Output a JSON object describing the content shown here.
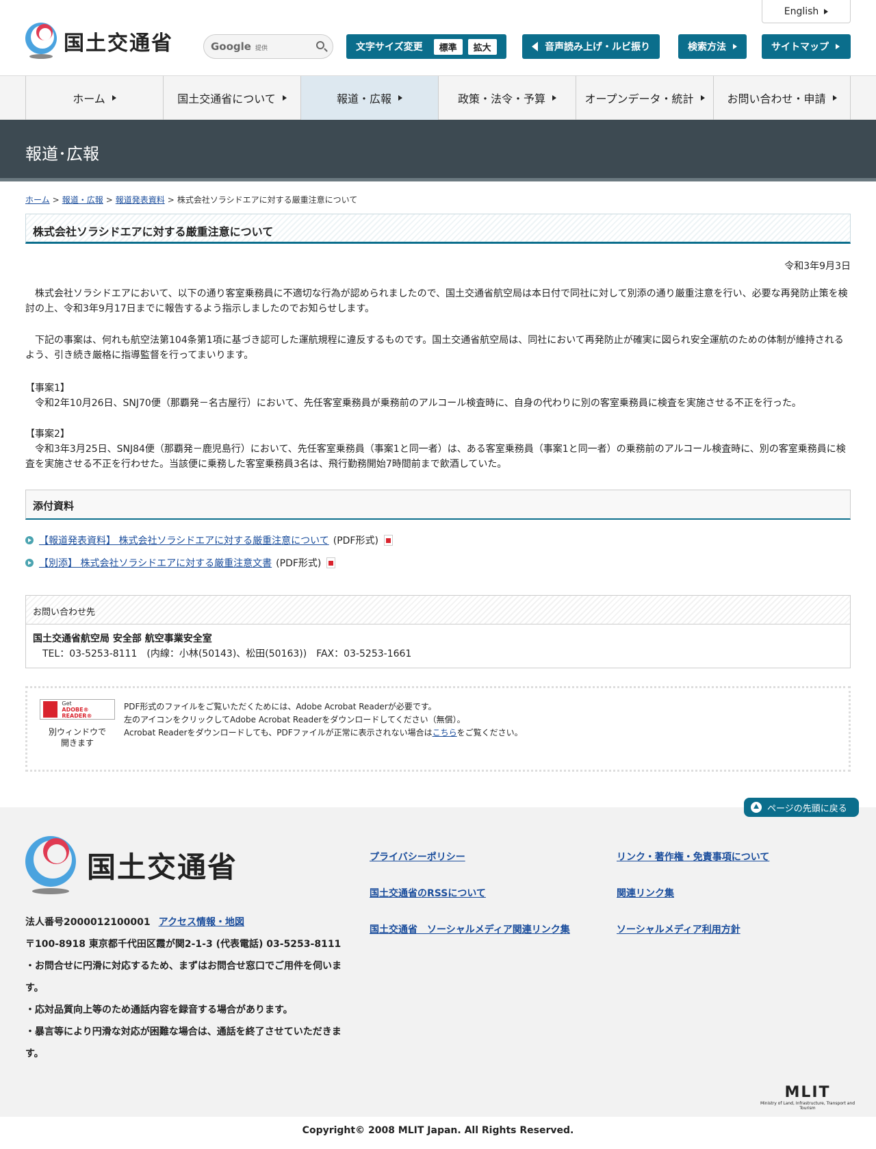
{
  "header": {
    "logo_text": "国土交通省",
    "english_label": "English",
    "search": {
      "brand": "Google",
      "provided": "提供"
    },
    "font_size": {
      "label": "文字サイズ変更",
      "standard": "標準",
      "large": "拡大"
    },
    "speech_label": "音声読み上げ・ルビ振り",
    "search_method_label": "検索方法",
    "sitemap_label": "サイトマップ"
  },
  "nav": {
    "items": [
      {
        "label": "ホーム"
      },
      {
        "label": "国土交通省について"
      },
      {
        "label": "報道・広報"
      },
      {
        "label": "政策・法令・予算"
      },
      {
        "label": "オープンデータ・統計"
      },
      {
        "label": "お問い合わせ・申請"
      }
    ]
  },
  "page_title": "報道･広報",
  "breadcrumb": {
    "home": "ホーム",
    "press": "報道・広報",
    "releases": "報道発表資料",
    "current": "株式会社ソラシドエアに対する厳重注意について",
    "sep": ">"
  },
  "article": {
    "title": "株式会社ソラシドエアに対する厳重注意について",
    "date": "令和3年9月3日",
    "para1": "　株式会社ソラシドエアにおいて、以下の通り客室乗務員に不適切な行為が認められましたので、国土交通省航空局は本日付で同社に対して別添の通り厳重注意を行い、必要な再発防止策を検討の上、令和3年9月17日までに報告するよう指示しましたのでお知らせします。",
    "para2": "　下記の事案は、何れも航空法第104条第1項に基づき認可した運航規程に違反するものです。国土交通省航空局は、同社において再発防止が確実に図られ安全運航のための体制が維持されるよう、引き続き厳格に指導監督を行ってまいります。",
    "case1_title": "【事案1】",
    "case1_body": "　令和2年10月26日、SNJ70便（那覇発－名古屋行）において、先任客室乗務員が乗務前のアルコール検査時に、自身の代わりに別の客室乗務員に検査を実施させる不正を行った。",
    "case2_title": "【事案2】",
    "case2_body": "　令和3年3月25日、SNJ84便（那覇発－鹿児島行）において、先任客室乗務員（事案1と同一者）は、ある客室乗務員（事案1と同一者）の乗務前のアルコール検査時に、別の客室乗務員に検査を実施させる不正を行わせた。当該便に乗務した客室乗務員3名は、飛行勤務開始7時間前まで飲酒していた。"
  },
  "attachments": {
    "heading": "添付資料",
    "files": [
      {
        "label": "【報道発表資料】 株式会社ソラシドエアに対する厳重注意について",
        "format": "(PDF形式)"
      },
      {
        "label": "【別添】 株式会社ソラシドエアに対する厳重注意文書",
        "format": "(PDF形式)"
      }
    ]
  },
  "contact": {
    "heading": "お問い合わせ先",
    "org": "国土交通省航空局 安全部 航空事業安全室",
    "tel": "　TEL：03-5253-8111　(内線：小林(50143)、松田(50163))　FAX：03-5253-1661"
  },
  "adobe": {
    "badge_get": "Get",
    "badge_name": "ADOBE® READER®",
    "window_note_1": "別ウィンドウで",
    "window_note_2": "開きます",
    "line1": "PDF形式のファイルをご覧いただくためには、Adobe Acrobat Readerが必要です。",
    "line2": "左のアイコンをクリックしてAdobe Acrobat Readerをダウンロードしてください（無償）。",
    "line3_pre": "Acrobat Readerをダウンロードしても、PDFファイルが正常に表示されない場合は",
    "line3_link": "こちら",
    "line3_post": "をご覧ください。"
  },
  "footer": {
    "page_top": "ページの先頭に戻る",
    "logo_text": "国土交通省",
    "corp_number": "法人番号2000012100001",
    "access_link": "アクセス情報・地図",
    "address": "〒100-8918 東京都千代田区霞が関2-1-3 (代表電話) 03-5253-8111",
    "note1": "・お問合せに円滑に対応するため、まずはお問合せ窓口でご用件を伺います。",
    "note2": "・応対品質向上等のため通話内容を録音する場合があります。",
    "note3": "・暴言等により円滑な対応が困難な場合は、通話を終了させていただきます。",
    "links": {
      "privacy": "プライバシーポリシー",
      "rss": "国土交通省のRSSについて",
      "social": "国土交通省　ソーシャルメディア関連リンク集",
      "copyright_link": "リンク・著作権・免責事項について",
      "related": "関連リンク集",
      "social_policy": "ソーシャルメディア利用方針"
    },
    "mlit": "MLIT",
    "mlit_sub": "Ministry of Land, Infrastructure, Transport and Tourism",
    "copyright": "Copyright© 2008 MLIT Japan. All Rights Reserved."
  }
}
